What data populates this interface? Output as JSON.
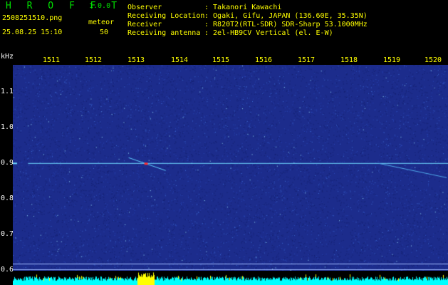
{
  "app": {
    "name": "H R O F F T",
    "version": "1.0.0"
  },
  "header": {
    "filename": "2508251510.png",
    "datetime": "25.08.25 15:10",
    "counter_label": "meteor",
    "counter_value": "50",
    "fields": [
      {
        "label": "Observer",
        "value": ": Takanori Kawachi"
      },
      {
        "label": "Receiving Location",
        "value": ": Ogaki, Gifu, JAPAN (136.60E, 35.35N)"
      },
      {
        "label": "Receiver",
        "value": ": R820T2(RTL-SDR) SDR-Sharp 53.1000MHz"
      },
      {
        "label": "Receiving antenna",
        "value": ": 2el-HB9CV Vertical (el. E-W)"
      }
    ]
  },
  "chart_data": {
    "type": "heatmap",
    "ylabel": "kHz",
    "x_ticks": [
      "1511",
      "1512",
      "1513",
      "1514",
      "1515",
      "1516",
      "1517",
      "1518",
      "1519",
      "1520"
    ],
    "y_ticks": [
      "1.1",
      "1.0",
      "0.9",
      "0.8",
      "0.7",
      "0.6"
    ],
    "x_range": [
      1510.67,
      1520.1
    ],
    "y_range": [
      0.6,
      1.185
    ],
    "signal_line_khz": 0.905,
    "meteor_echo_x": 1513.55,
    "colors": {
      "background": "#1c2c8c",
      "signal": "#6fd8ff",
      "echo": "#ff3030",
      "power_bar": "#00ffff",
      "power_peak": "#ffff00"
    }
  }
}
